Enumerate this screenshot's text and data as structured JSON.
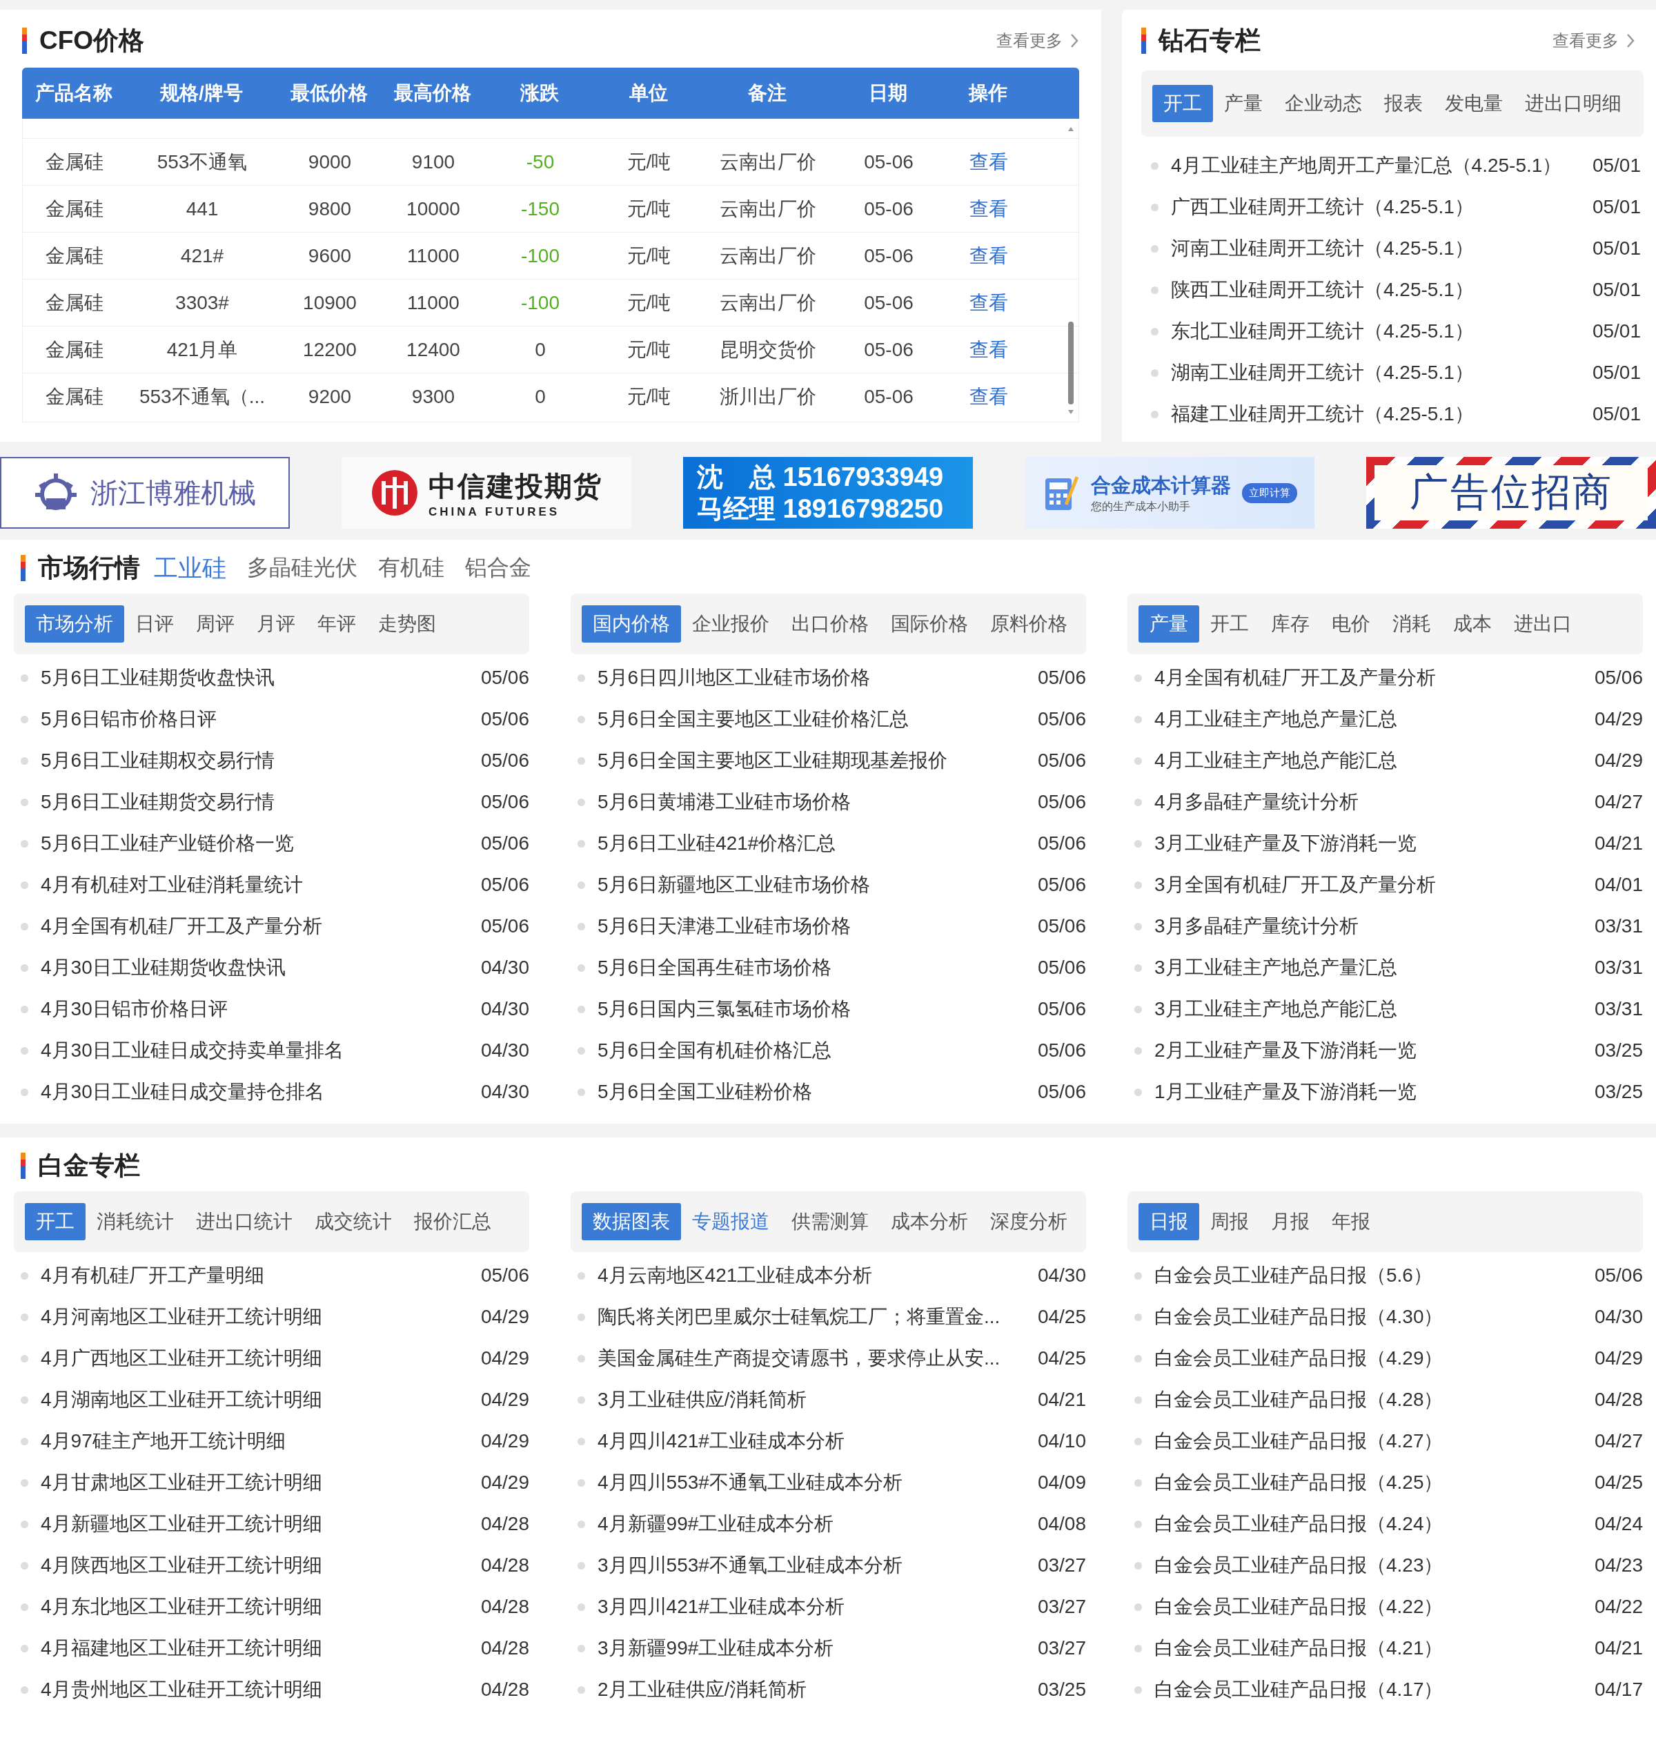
{
  "cfo": {
    "title": "CFO价格",
    "more": "查看更多",
    "columns": [
      "产品名称",
      "规格/牌号",
      "最低价格",
      "最高价格",
      "涨跌",
      "单位",
      "备注",
      "日期",
      "操作"
    ],
    "rows": [
      {
        "name": "金属硅",
        "spec": "553不通氧",
        "low": "9000",
        "high": "9100",
        "change": "-50",
        "color": "#52b01c",
        "unit": "元/吨",
        "note": "云南出厂价",
        "date": "05-06",
        "action": "查看"
      },
      {
        "name": "金属硅",
        "spec": "441",
        "low": "9800",
        "high": "10000",
        "change": "-150",
        "color": "#52b01c",
        "unit": "元/吨",
        "note": "云南出厂价",
        "date": "05-06",
        "action": "查看"
      },
      {
        "name": "金属硅",
        "spec": "421#",
        "low": "9600",
        "high": "11000",
        "change": "-100",
        "color": "#52b01c",
        "unit": "元/吨",
        "note": "云南出厂价",
        "date": "05-06",
        "action": "查看"
      },
      {
        "name": "金属硅",
        "spec": "3303#",
        "low": "10900",
        "high": "11000",
        "change": "-100",
        "color": "#52b01c",
        "unit": "元/吨",
        "note": "云南出厂价",
        "date": "05-06",
        "action": "查看"
      },
      {
        "name": "金属硅",
        "spec": "421月单",
        "low": "12200",
        "high": "12400",
        "change": "0",
        "color": "#444444",
        "unit": "元/吨",
        "note": "昆明交货价",
        "date": "05-06",
        "action": "查看"
      },
      {
        "name": "金属硅",
        "spec": "553不通氧（...",
        "low": "9200",
        "high": "9300",
        "change": "0",
        "color": "#444444",
        "unit": "元/吨",
        "note": "浙川出厂价",
        "date": "05-06",
        "action": "查看"
      }
    ]
  },
  "diamond": {
    "title": "钻石专栏",
    "more": "查看更多",
    "tabs": [
      {
        "label": "开工",
        "selected": true
      },
      {
        "label": "产量",
        "selected": false
      },
      {
        "label": "企业动态",
        "selected": false
      },
      {
        "label": "报表",
        "selected": false
      },
      {
        "label": "发电量",
        "selected": false
      },
      {
        "label": "进出口明细",
        "selected": false
      }
    ],
    "items": [
      {
        "title": "4月工业硅主产地周开工产量汇总（4.25-5.1）",
        "date": "05/01"
      },
      {
        "title": "广西工业硅周开工统计（4.25-5.1）",
        "date": "05/01"
      },
      {
        "title": "河南工业硅周开工统计（4.25-5.1）",
        "date": "05/01"
      },
      {
        "title": "陕西工业硅周开工统计（4.25-5.1）",
        "date": "05/01"
      },
      {
        "title": "东北工业硅周开工统计（4.25-5.1）",
        "date": "05/01"
      },
      {
        "title": "湖南工业硅周开工统计（4.25-5.1）",
        "date": "05/01"
      },
      {
        "title": "福建工业硅周开工统计（4.25-5.1）",
        "date": "05/01"
      }
    ]
  },
  "banners": [
    {
      "kind": "machinery",
      "text": "浙江博雅机械"
    },
    {
      "kind": "futures",
      "title": "中信建投期货",
      "subtitle": "CHINA FUTURES"
    },
    {
      "kind": "contact",
      "lines": [
        "沈　总 15167933949",
        "马经理 18916798250"
      ]
    },
    {
      "kind": "calculator",
      "title": "合金成本计算器",
      "subtitle": "您的生产成本小助手",
      "button": "立即计算"
    },
    {
      "kind": "ad",
      "text": "广告位招商"
    }
  ],
  "market": {
    "title": "市场行情",
    "tabs": [
      {
        "label": "工业硅",
        "selected": true
      },
      {
        "label": "多晶硅光伏",
        "selected": false
      },
      {
        "label": "有机硅",
        "selected": false
      },
      {
        "label": "铝合金",
        "selected": false
      }
    ],
    "columns": [
      {
        "tabs": [
          {
            "label": "市场分析",
            "selected": true
          },
          {
            "label": "日评",
            "selected": false
          },
          {
            "label": "周评",
            "selected": false
          },
          {
            "label": "月评",
            "selected": false
          },
          {
            "label": "年评",
            "selected": false
          },
          {
            "label": "走势图",
            "selected": false
          }
        ],
        "items": [
          {
            "title": "5月6日工业硅期货收盘快讯",
            "date": "05/06"
          },
          {
            "title": "5月6日铝市价格日评",
            "date": "05/06"
          },
          {
            "title": "5月6日工业硅期权交易行情",
            "date": "05/06"
          },
          {
            "title": "5月6日工业硅期货交易行情",
            "date": "05/06"
          },
          {
            "title": "5月6日工业硅产业链价格一览",
            "date": "05/06"
          },
          {
            "title": "4月有机硅对工业硅消耗量统计",
            "date": "05/06"
          },
          {
            "title": "4月全国有机硅厂开工及产量分析",
            "date": "05/06"
          },
          {
            "title": "4月30日工业硅期货收盘快讯",
            "date": "04/30"
          },
          {
            "title": "4月30日铝市价格日评",
            "date": "04/30"
          },
          {
            "title": "4月30日工业硅日成交持卖单量排名",
            "date": "04/30"
          },
          {
            "title": "4月30日工业硅日成交量持仓排名",
            "date": "04/30"
          }
        ]
      },
      {
        "tabs": [
          {
            "label": "国内价格",
            "selected": true
          },
          {
            "label": "企业报价",
            "selected": false
          },
          {
            "label": "出口价格",
            "selected": false
          },
          {
            "label": "国际价格",
            "selected": false
          },
          {
            "label": "原料价格",
            "selected": false
          }
        ],
        "items": [
          {
            "title": "5月6日四川地区工业硅市场价格",
            "date": "05/06"
          },
          {
            "title": "5月6日全国主要地区工业硅价格汇总",
            "date": "05/06"
          },
          {
            "title": "5月6日全国主要地区工业硅期现基差报价",
            "date": "05/06"
          },
          {
            "title": "5月6日黄埔港工业硅市场价格",
            "date": "05/06"
          },
          {
            "title": "5月6日工业硅421#价格汇总",
            "date": "05/06"
          },
          {
            "title": "5月6日新疆地区工业硅市场价格",
            "date": "05/06"
          },
          {
            "title": "5月6日天津港工业硅市场价格",
            "date": "05/06"
          },
          {
            "title": "5月6日全国再生硅市场价格",
            "date": "05/06"
          },
          {
            "title": "5月6日国内三氯氢硅市场价格",
            "date": "05/06"
          },
          {
            "title": "5月6日全国有机硅价格汇总",
            "date": "05/06"
          },
          {
            "title": "5月6日全国工业硅粉价格",
            "date": "05/06"
          }
        ]
      },
      {
        "tabs": [
          {
            "label": "产量",
            "selected": true
          },
          {
            "label": "开工",
            "selected": false
          },
          {
            "label": "库存",
            "selected": false
          },
          {
            "label": "电价",
            "selected": false
          },
          {
            "label": "消耗",
            "selected": false
          },
          {
            "label": "成本",
            "selected": false
          },
          {
            "label": "进出口",
            "selected": false
          }
        ],
        "items": [
          {
            "title": "4月全国有机硅厂开工及产量分析",
            "date": "05/06"
          },
          {
            "title": "4月工业硅主产地总产量汇总",
            "date": "04/29"
          },
          {
            "title": "4月工业硅主产地总产能汇总",
            "date": "04/29"
          },
          {
            "title": "4月多晶硅产量统计分析",
            "date": "04/27"
          },
          {
            "title": "3月工业硅产量及下游消耗一览",
            "date": "04/21"
          },
          {
            "title": "3月全国有机硅厂开工及产量分析",
            "date": "04/01"
          },
          {
            "title": "3月多晶硅产量统计分析",
            "date": "03/31"
          },
          {
            "title": "3月工业硅主产地总产量汇总",
            "date": "03/31"
          },
          {
            "title": "3月工业硅主产地总产能汇总",
            "date": "03/31"
          },
          {
            "title": "2月工业硅产量及下游消耗一览",
            "date": "03/25"
          },
          {
            "title": "1月工业硅产量及下游消耗一览",
            "date": "03/25"
          }
        ]
      }
    ]
  },
  "platinum": {
    "title": "白金专栏",
    "columns": [
      {
        "tabs": [
          {
            "label": "开工",
            "selected": true
          },
          {
            "label": "消耗统计",
            "selected": false
          },
          {
            "label": "进出口统计",
            "selected": false
          },
          {
            "label": "成交统计",
            "selected": false
          },
          {
            "label": "报价汇总",
            "selected": false
          }
        ],
        "items": [
          {
            "title": "4月有机硅厂开工产量明细",
            "date": "05/06"
          },
          {
            "title": "4月河南地区工业硅开工统计明细",
            "date": "04/29"
          },
          {
            "title": "4月广西地区工业硅开工统计明细",
            "date": "04/29"
          },
          {
            "title": "4月湖南地区工业硅开工统计明细",
            "date": "04/29"
          },
          {
            "title": "4月97硅主产地开工统计明细",
            "date": "04/29"
          },
          {
            "title": "4月甘肃地区工业硅开工统计明细",
            "date": "04/29"
          },
          {
            "title": "4月新疆地区工业硅开工统计明细",
            "date": "04/28"
          },
          {
            "title": "4月陕西地区工业硅开工统计明细",
            "date": "04/28"
          },
          {
            "title": "4月东北地区工业硅开工统计明细",
            "date": "04/28"
          },
          {
            "title": "4月福建地区工业硅开工统计明细",
            "date": "04/28"
          },
          {
            "title": "4月贵州地区工业硅开工统计明细",
            "date": "04/28"
          }
        ]
      },
      {
        "tabs": [
          {
            "label": "数据图表",
            "selected": true,
            "highlighted": false
          },
          {
            "label": "专题报道",
            "selected": false,
            "highlighted": true
          },
          {
            "label": "供需测算",
            "selected": false,
            "highlighted": false
          },
          {
            "label": "成本分析",
            "selected": false,
            "highlighted": false
          },
          {
            "label": "深度分析",
            "selected": false,
            "highlighted": false
          }
        ],
        "items": [
          {
            "title": "4月云南地区421工业硅成本分析",
            "date": "04/30"
          },
          {
            "title": "陶氏将关闭巴里威尔士硅氧烷工厂；将重置金...",
            "date": "04/25"
          },
          {
            "title": "美国金属硅生产商提交请愿书，要求停止从安...",
            "date": "04/25"
          },
          {
            "title": "3月工业硅供应/消耗简析",
            "date": "04/21"
          },
          {
            "title": "4月四川421#工业硅成本分析",
            "date": "04/10"
          },
          {
            "title": "4月四川553#不通氧工业硅成本分析",
            "date": "04/09"
          },
          {
            "title": "4月新疆99#工业硅成本分析",
            "date": "04/08"
          },
          {
            "title": "3月四川553#不通氧工业硅成本分析",
            "date": "03/27"
          },
          {
            "title": "3月四川421#工业硅成本分析",
            "date": "03/27"
          },
          {
            "title": "3月新疆99#工业硅成本分析",
            "date": "03/27"
          },
          {
            "title": "2月工业硅供应/消耗简析",
            "date": "03/25"
          }
        ]
      },
      {
        "tabs": [
          {
            "label": "日报",
            "selected": true
          },
          {
            "label": "周报",
            "selected": false
          },
          {
            "label": "月报",
            "selected": false
          },
          {
            "label": "年报",
            "selected": false
          }
        ],
        "items": [
          {
            "title": "白金会员工业硅产品日报（5.6）",
            "date": "05/06"
          },
          {
            "title": "白金会员工业硅产品日报（4.30）",
            "date": "04/30"
          },
          {
            "title": "白金会员工业硅产品日报（4.29）",
            "date": "04/29"
          },
          {
            "title": "白金会员工业硅产品日报（4.28）",
            "date": "04/28"
          },
          {
            "title": "白金会员工业硅产品日报（4.27）",
            "date": "04/27"
          },
          {
            "title": "白金会员工业硅产品日报（4.25）",
            "date": "04/25"
          },
          {
            "title": "白金会员工业硅产品日报（4.24）",
            "date": "04/24"
          },
          {
            "title": "白金会员工业硅产品日报（4.23）",
            "date": "04/23"
          },
          {
            "title": "白金会员工业硅产品日报（4.22）",
            "date": "04/22"
          },
          {
            "title": "白金会员工业硅产品日报（4.21）",
            "date": "04/21"
          },
          {
            "title": "白金会员工业硅产品日报（4.17）",
            "date": "04/17"
          }
        ]
      }
    ]
  }
}
